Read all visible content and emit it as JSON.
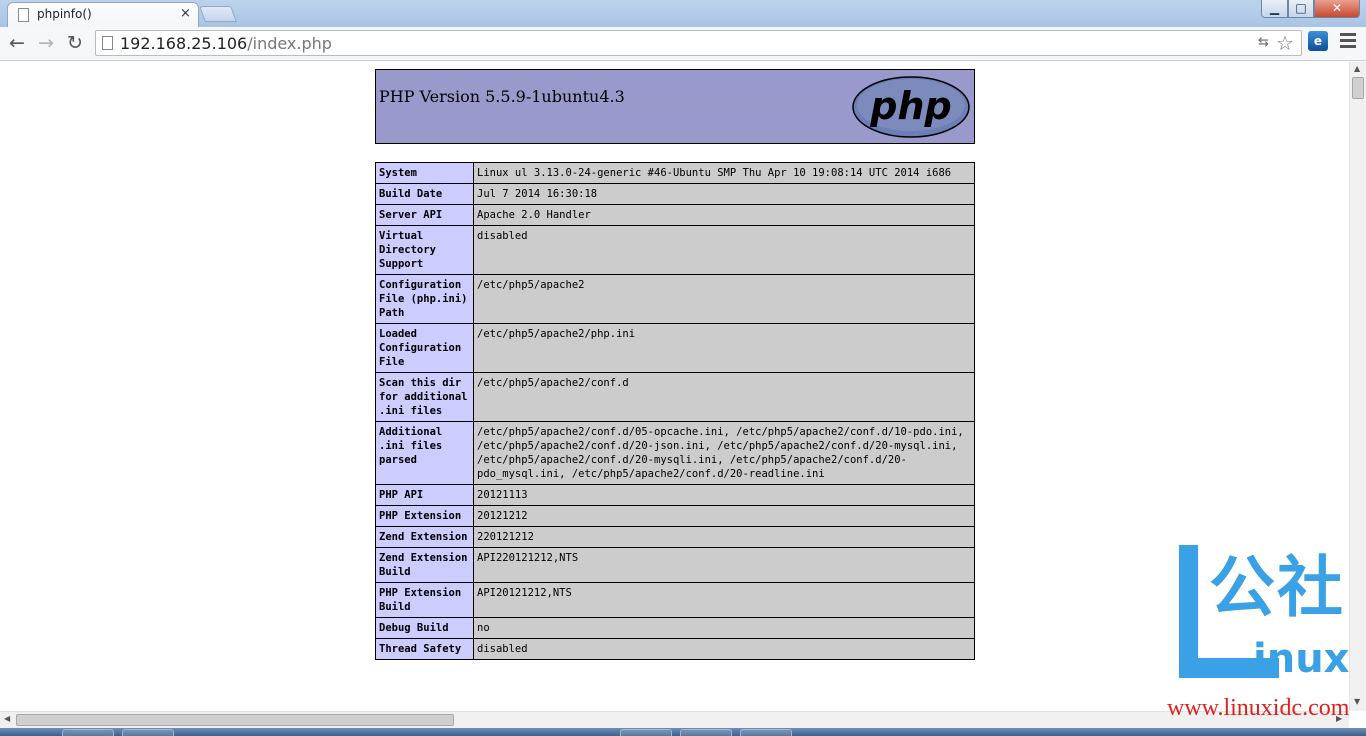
{
  "window": {
    "tab_title": "phpinfo()",
    "tab_close": "×",
    "minimize": "▁",
    "maximize": "□",
    "close": "✕"
  },
  "toolbar": {
    "back": "←",
    "forward": "→",
    "reload": "↻",
    "url_host": "192.168.25.106",
    "url_path": "/index.php",
    "star": "☆",
    "translate": "⇆"
  },
  "page": {
    "version_title": "PHP Version 5.5.9-1ubuntu4.3",
    "logo_text": "php",
    "rows": [
      {
        "key": "System",
        "value": "Linux ul 3.13.0-24-generic #46-Ubuntu SMP Thu Apr 10 19:08:14 UTC 2014 i686"
      },
      {
        "key": "Build Date",
        "value": "Jul 7 2014 16:30:18"
      },
      {
        "key": "Server API",
        "value": "Apache 2.0 Handler"
      },
      {
        "key": "Virtual Directory Support",
        "value": "disabled"
      },
      {
        "key": "Configuration File (php.ini) Path",
        "value": "/etc/php5/apache2"
      },
      {
        "key": "Loaded Configuration File",
        "value": "/etc/php5/apache2/php.ini"
      },
      {
        "key": "Scan this dir for additional .ini files",
        "value": "/etc/php5/apache2/conf.d"
      },
      {
        "key": "Additional .ini files parsed",
        "value": "/etc/php5/apache2/conf.d/05-opcache.ini, /etc/php5/apache2/conf.d/10-pdo.ini, /etc/php5/apache2/conf.d/20-json.ini, /etc/php5/apache2/conf.d/20-mysql.ini, /etc/php5/apache2/conf.d/20-mysqli.ini, /etc/php5/apache2/conf.d/20-pdo_mysql.ini, /etc/php5/apache2/conf.d/20-readline.ini"
      },
      {
        "key": "PHP API",
        "value": "20121113"
      },
      {
        "key": "PHP Extension",
        "value": "20121212"
      },
      {
        "key": "Zend Extension",
        "value": "220121212"
      },
      {
        "key": "Zend Extension Build",
        "value": "API220121212,NTS"
      },
      {
        "key": "PHP Extension Build",
        "value": "API20121212,NTS"
      },
      {
        "key": "Debug Build",
        "value": "no"
      },
      {
        "key": "Thread Safety",
        "value": "disabled"
      }
    ]
  },
  "watermark": {
    "chinese": "公社",
    "inux": "inux",
    "site": "www.linuxidc.com"
  }
}
